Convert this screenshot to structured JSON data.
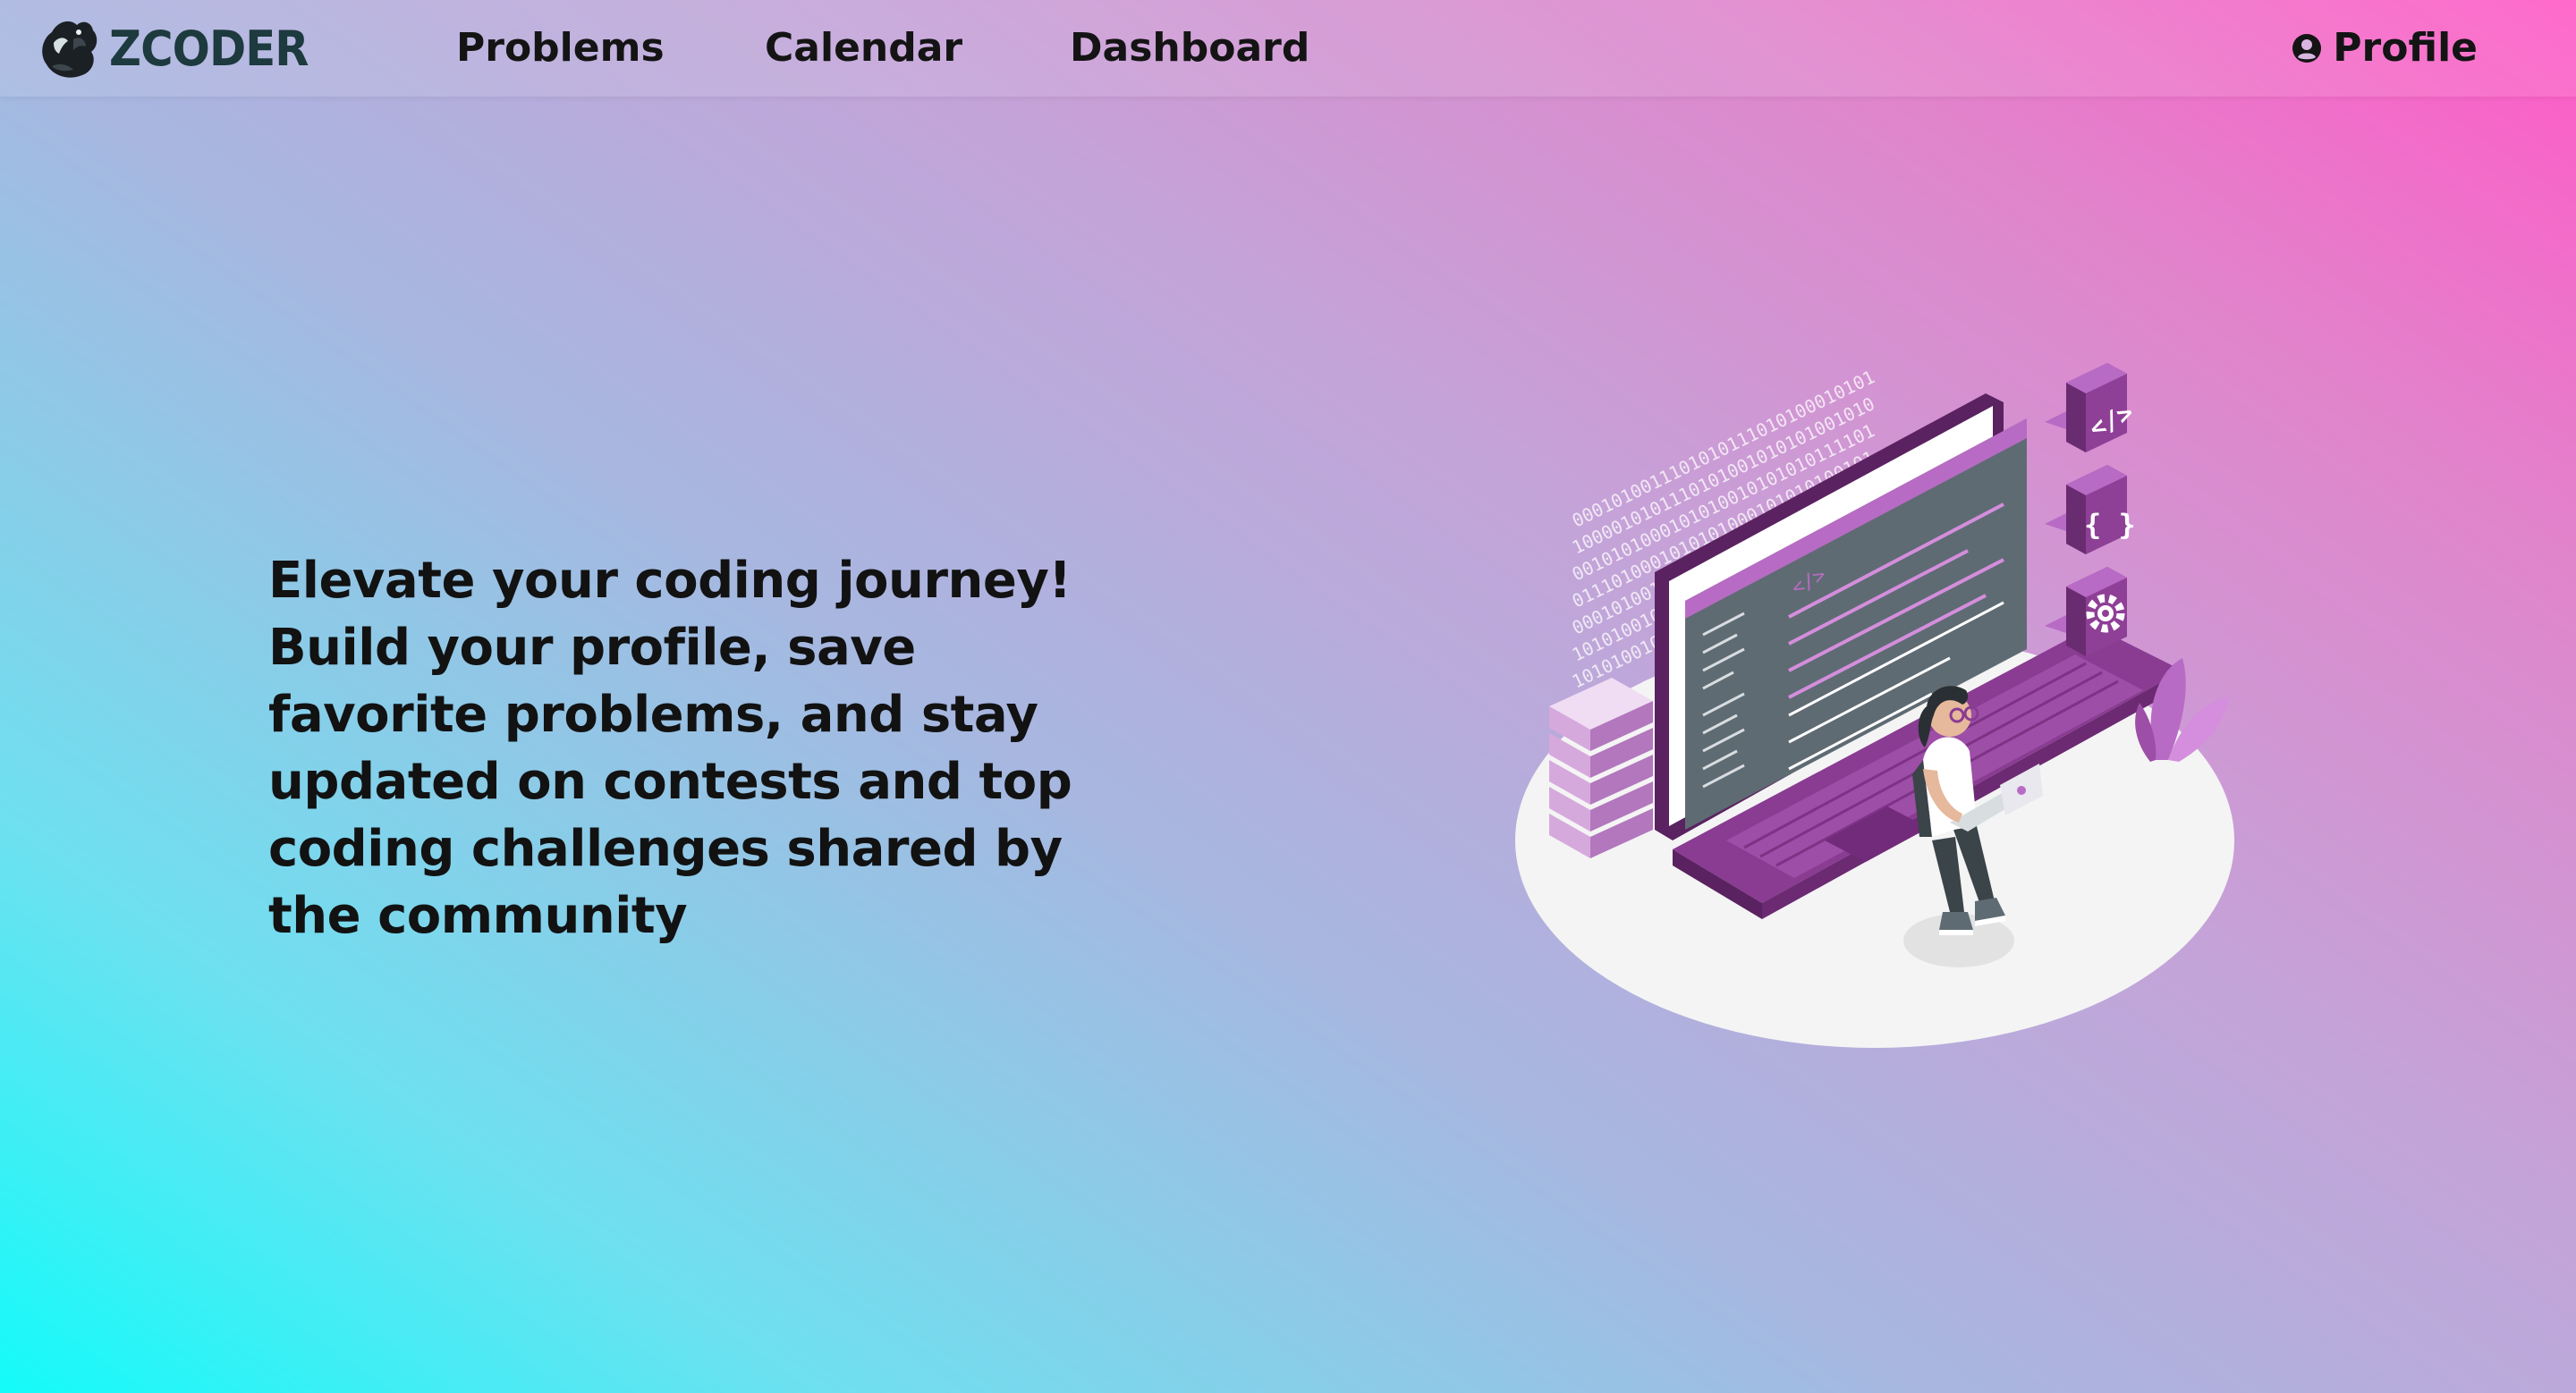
{
  "brand": {
    "name": "ZCODER",
    "logo_icon": "squirrel-logo-icon"
  },
  "nav": {
    "problems": "Problems",
    "calendar": "Calendar",
    "dashboard": "Dashboard",
    "profile": "Profile",
    "profile_icon": "user-circle-icon"
  },
  "hero": {
    "text": "Elevate your coding journey! Build your profile, save favorite problems, and stay updated on contests and top coding challenges shared by the community"
  },
  "illustration": {
    "binary_lines": [
      "0001010011101010111010100010101",
      "1000010101110101001010101001010",
      "0010101000101010010101010111101",
      "0111010001010101000101010100101",
      "0001010011101010",
      "1010100101",
      "1010100101"
    ],
    "code_tag": "</>",
    "brace_tag": "{ }",
    "gear_icon": "gear-icon",
    "code_icon": "code-tag-icon",
    "brace_icon": "curly-braces-icon"
  },
  "colors": {
    "purple_dark": "#6a2c70",
    "purple": "#8e3f96",
    "purple_light": "#b86bc4",
    "purple_pale": "#e7c6ec",
    "screen": "#5f6b73",
    "text": "#121212"
  }
}
